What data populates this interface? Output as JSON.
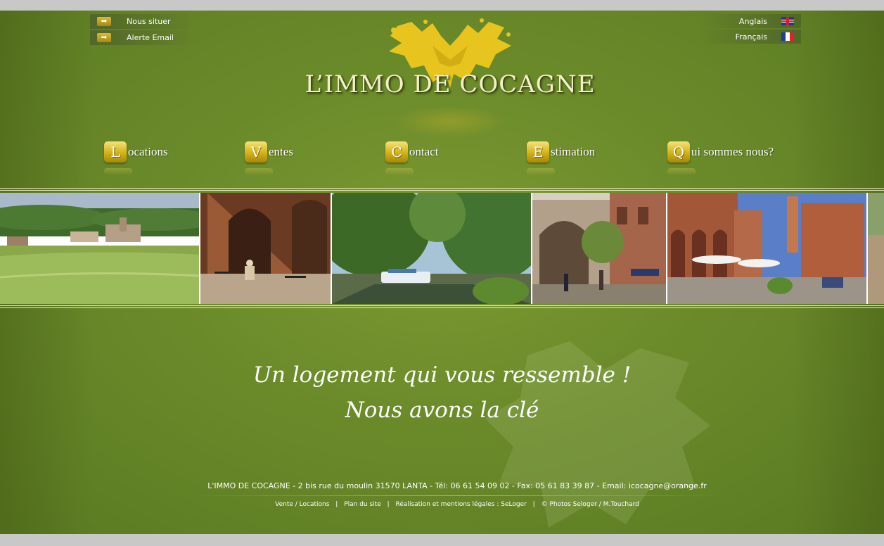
{
  "top_links": [
    {
      "label": "Nous situer",
      "icon": "arrow-right-icon"
    },
    {
      "label": "Alerte Email",
      "icon": "arrow-right-icon"
    }
  ],
  "languages": [
    {
      "label": "Anglais",
      "icon": "uk-flag-icon"
    },
    {
      "label": "Français",
      "icon": "france-flag-icon"
    }
  ],
  "logo": {
    "text": "L’IMMO DE COCAGNE"
  },
  "nav": [
    {
      "initial": "L",
      "rest": "ocations"
    },
    {
      "initial": "V",
      "rest": "entes"
    },
    {
      "initial": "C",
      "rest": "ontact"
    },
    {
      "initial": "E",
      "rest": "stimation"
    },
    {
      "initial": "Q",
      "rest": "ui sommes nous?"
    }
  ],
  "slogan": {
    "line1": "Un logement qui vous ressemble !",
    "line2": "Nous avons la clé"
  },
  "footer": {
    "address": "L'IMMO DE COCAGNE - 2 bis rue du moulin  31570   LANTA - Tél: 06 61 54 09 02 - Fax: 05 61 83 39 87 - Email: icocagne@orange.fr",
    "links": [
      "Vente / Locations",
      "Plan du site",
      "Réalisation et mentions légales : SeLoger",
      "© Photos Seloger / M.Touchard"
    ],
    "separator": "|"
  },
  "colors": {
    "background": "#6a8a2a",
    "accent_gold": "#d3b116",
    "page_outer": "#c8c8c8"
  }
}
